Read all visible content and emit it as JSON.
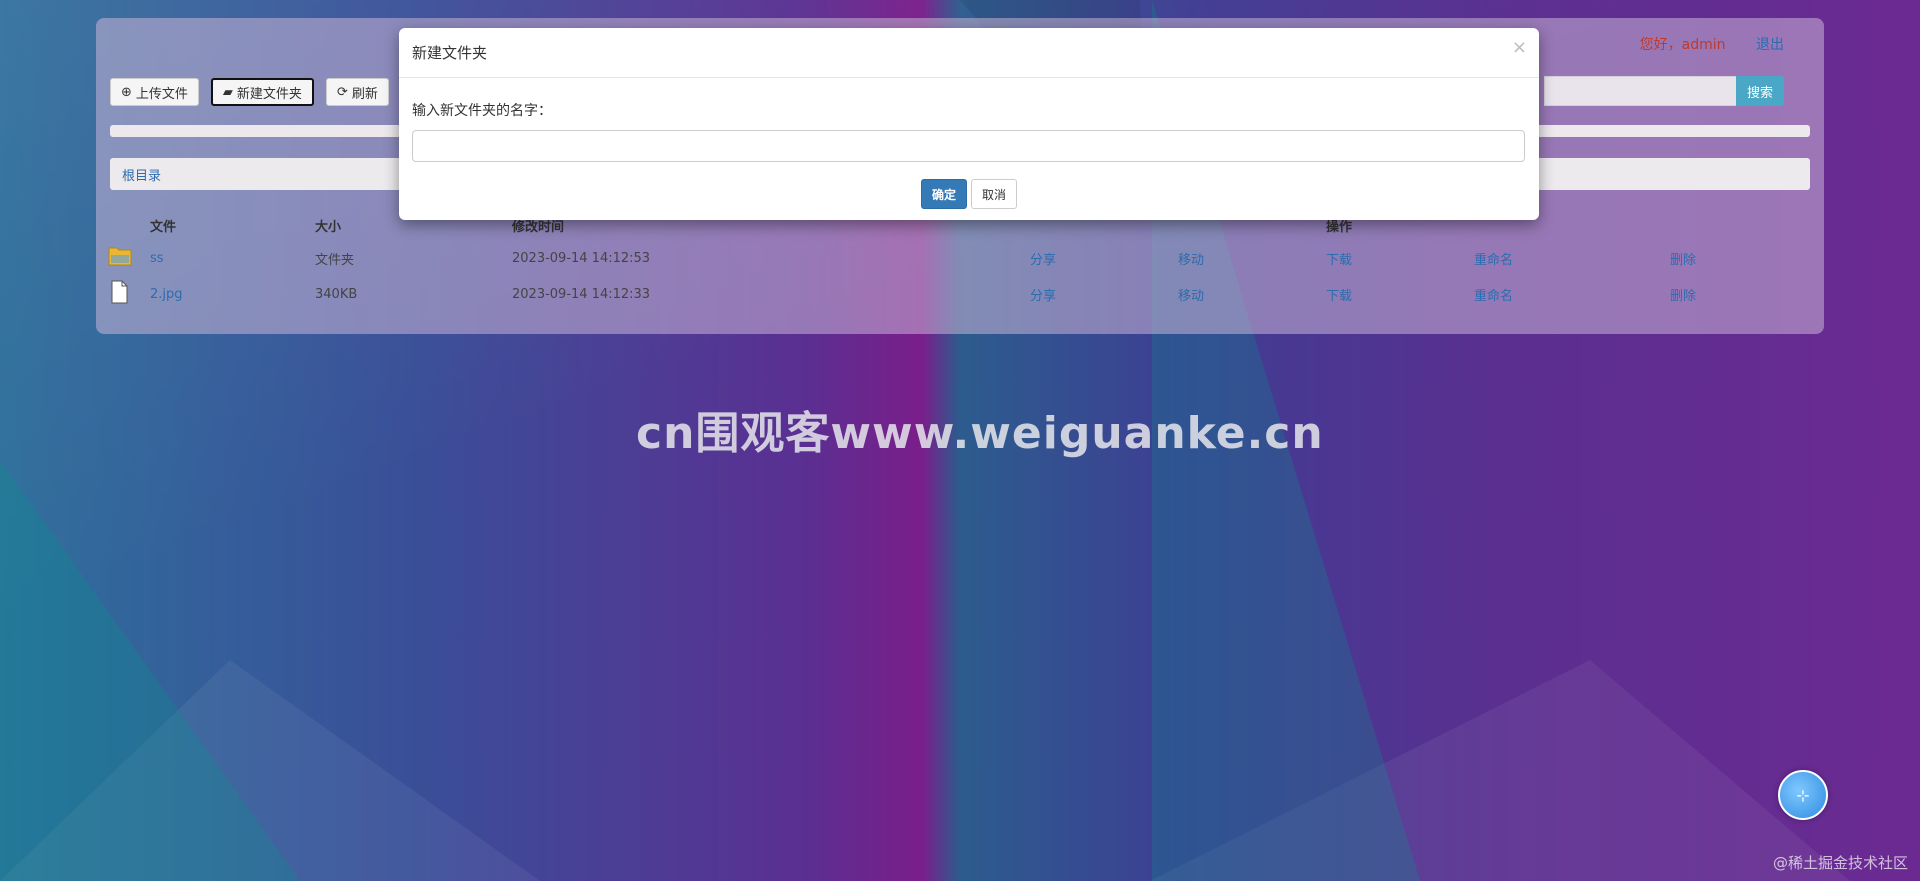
{
  "header": {
    "greeting": "您好，admin",
    "logout": "退出"
  },
  "toolbar": {
    "upload": "上传文件",
    "new_folder": "新建文件夹",
    "refresh": "刷新"
  },
  "search": {
    "button": "搜索",
    "placeholder": ""
  },
  "breadcrumb": "根目录",
  "table": {
    "headers": {
      "name": "文件",
      "size": "大小",
      "time": "修改时间",
      "actions": "操作"
    },
    "rows": [
      {
        "name": "ss",
        "size": "文件夹",
        "time": "2023-09-14 14:12:53",
        "share": "分享",
        "move": "移动",
        "download": "下载",
        "rename": "重命名",
        "delete": "删除",
        "icon": "folder-icon"
      },
      {
        "name": "2.jpg",
        "size": "340KB",
        "time": "2023-09-14 14:12:33",
        "share": "分享",
        "move": "移动",
        "download": "下载",
        "rename": "重命名",
        "delete": "删除",
        "icon": "file-icon"
      }
    ]
  },
  "modal": {
    "title": "新建文件夹",
    "close": "×",
    "label": "输入新文件夹的名字：",
    "input_value": "",
    "confirm": "确定",
    "cancel": "取消"
  },
  "watermark": "cn围观客www.weiguanke.cn",
  "corner_mark": "@稀土掘金技术社区",
  "colors": {
    "primary": "#337ab7",
    "search": "#4aa7c6",
    "greeting": "#c0392b",
    "link": "#2b6cb0"
  }
}
